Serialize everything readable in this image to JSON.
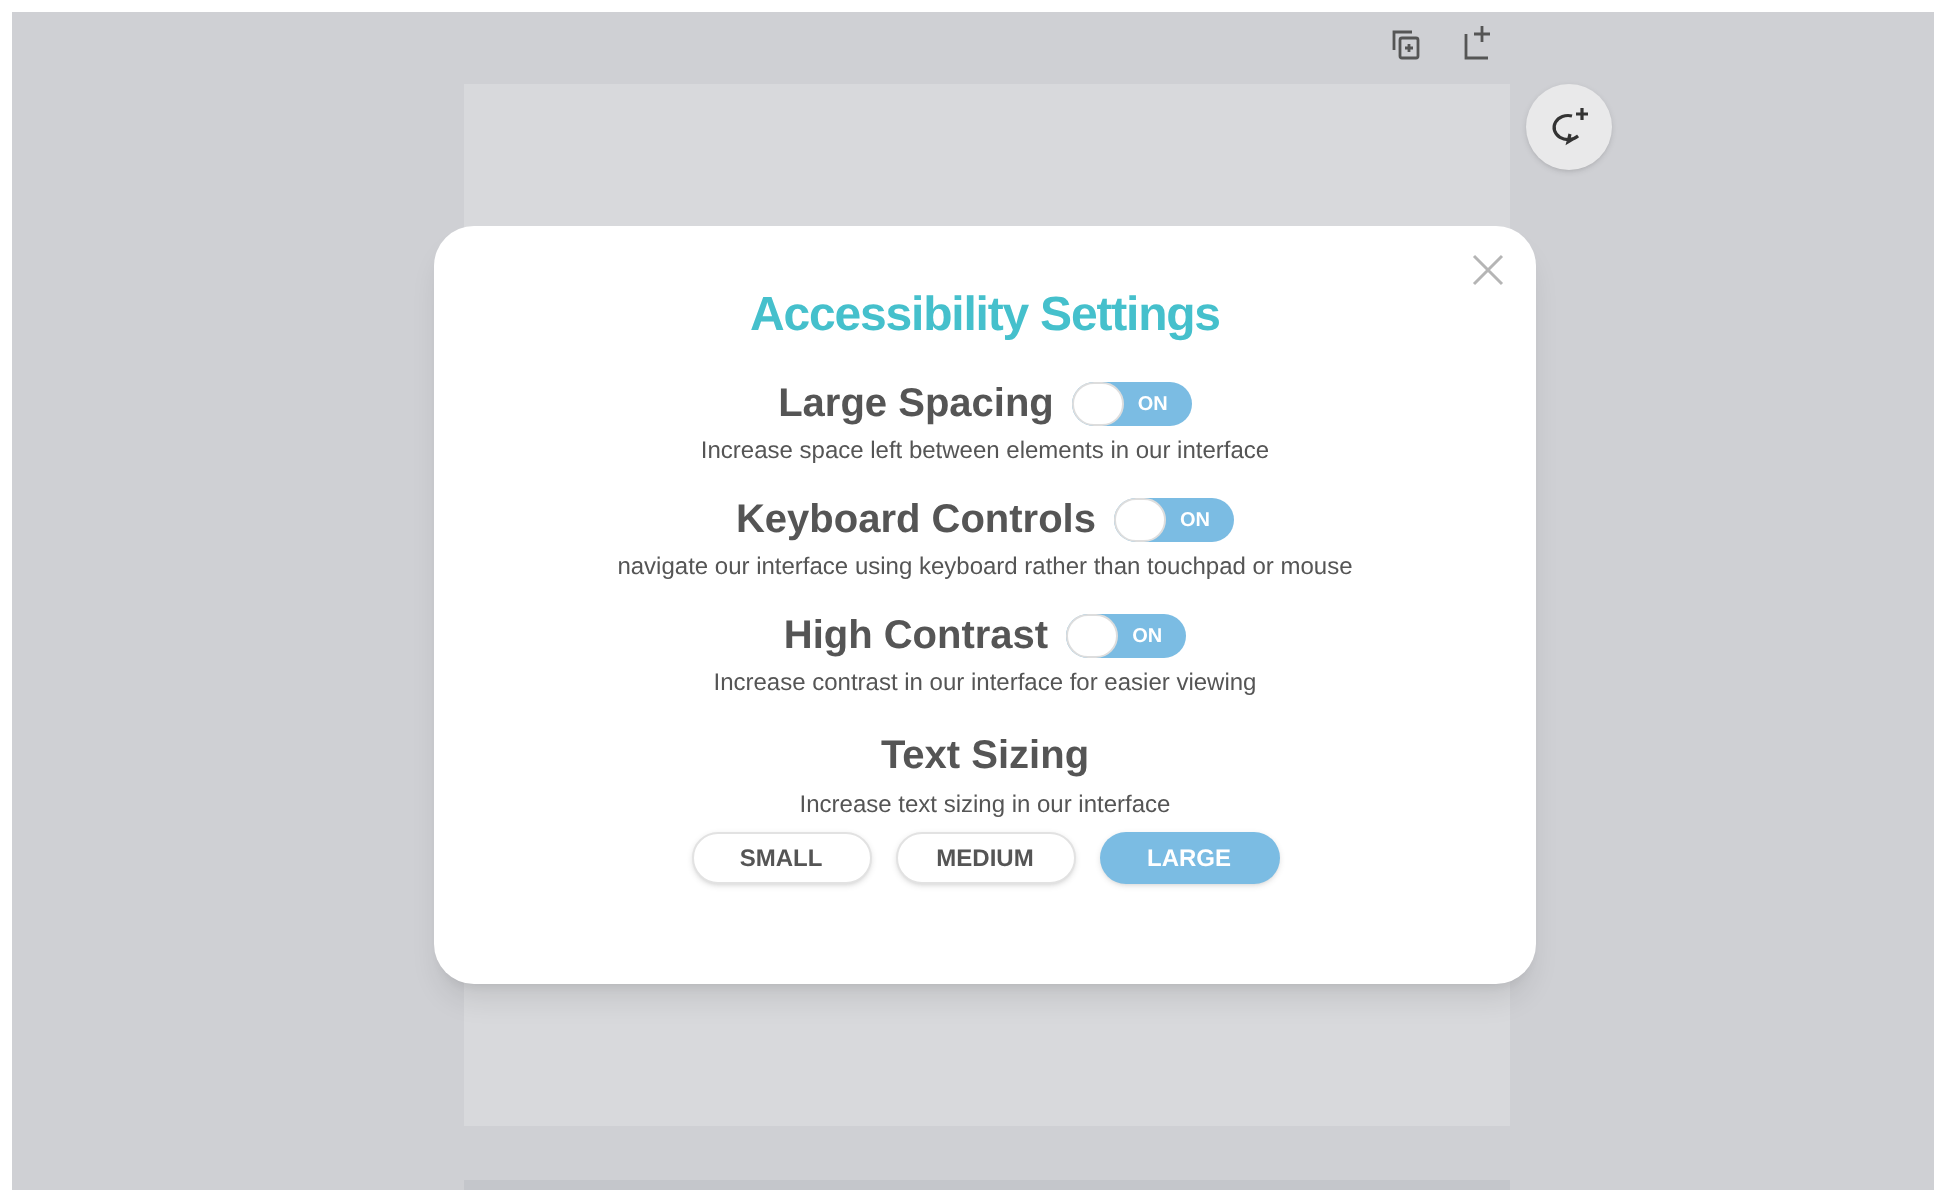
{
  "dialog": {
    "title": "Accessibility Settings",
    "settings": [
      {
        "label": "Large Spacing",
        "toggle_text": "ON",
        "on": false,
        "description": "Increase space left between elements in our interface"
      },
      {
        "label": "Keyboard Controls",
        "toggle_text": "ON",
        "on": false,
        "description": "navigate our interface using keyboard rather than touchpad or mouse"
      },
      {
        "label": "High Contrast",
        "toggle_text": "ON",
        "on": false,
        "description": "Increase contrast in our interface for easier viewing"
      }
    ],
    "text_sizing": {
      "label": "Text Sizing",
      "description": "Increase text sizing in our interface",
      "options": [
        {
          "label": "SMALL",
          "selected": false
        },
        {
          "label": "MEDIUM",
          "selected": false
        },
        {
          "label": "LARGE",
          "selected": true
        }
      ]
    }
  }
}
